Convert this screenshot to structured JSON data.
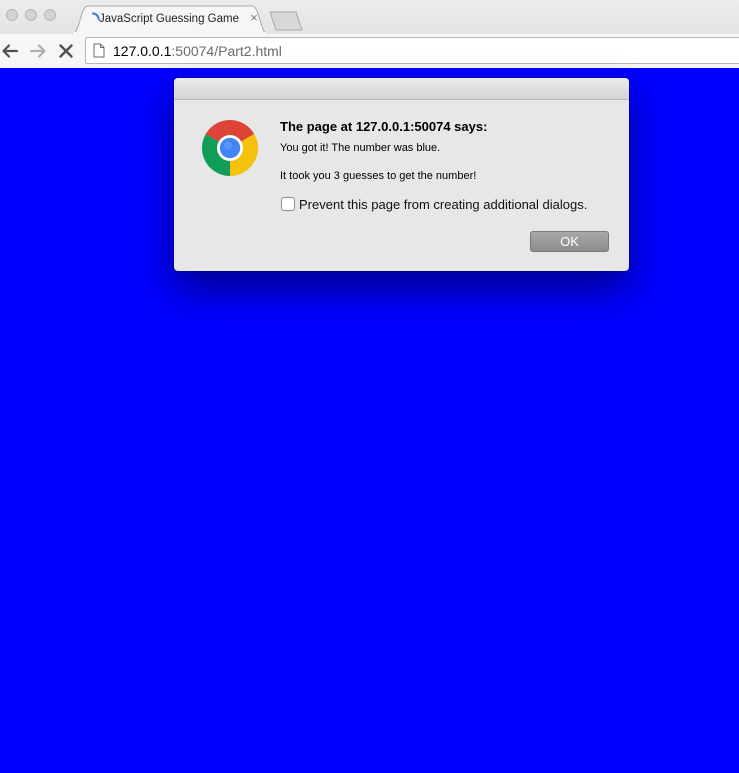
{
  "browser": {
    "tab": {
      "title": "JavaScript Guessing Game",
      "close_glyph": "×"
    },
    "address_bar": {
      "host": "127.0.0.1",
      "path": ":50074/Part2.html"
    },
    "icons": {
      "back": "back-arrow-icon",
      "forward": "forward-arrow-icon",
      "stop": "stop-icon",
      "page": "page-icon",
      "loading": "loading-spinner-icon"
    }
  },
  "page": {
    "background_color": "#0000ff"
  },
  "dialog": {
    "heading": "The page at 127.0.0.1:50074 says:",
    "message_line1": "You got it! The number was blue.",
    "message_line2": "It took you 3 guesses to get the number!",
    "checkbox_label": "Prevent this page from creating additional dialogs.",
    "checkbox_checked": false,
    "ok_label": "OK",
    "icon": "chrome-logo-icon"
  }
}
